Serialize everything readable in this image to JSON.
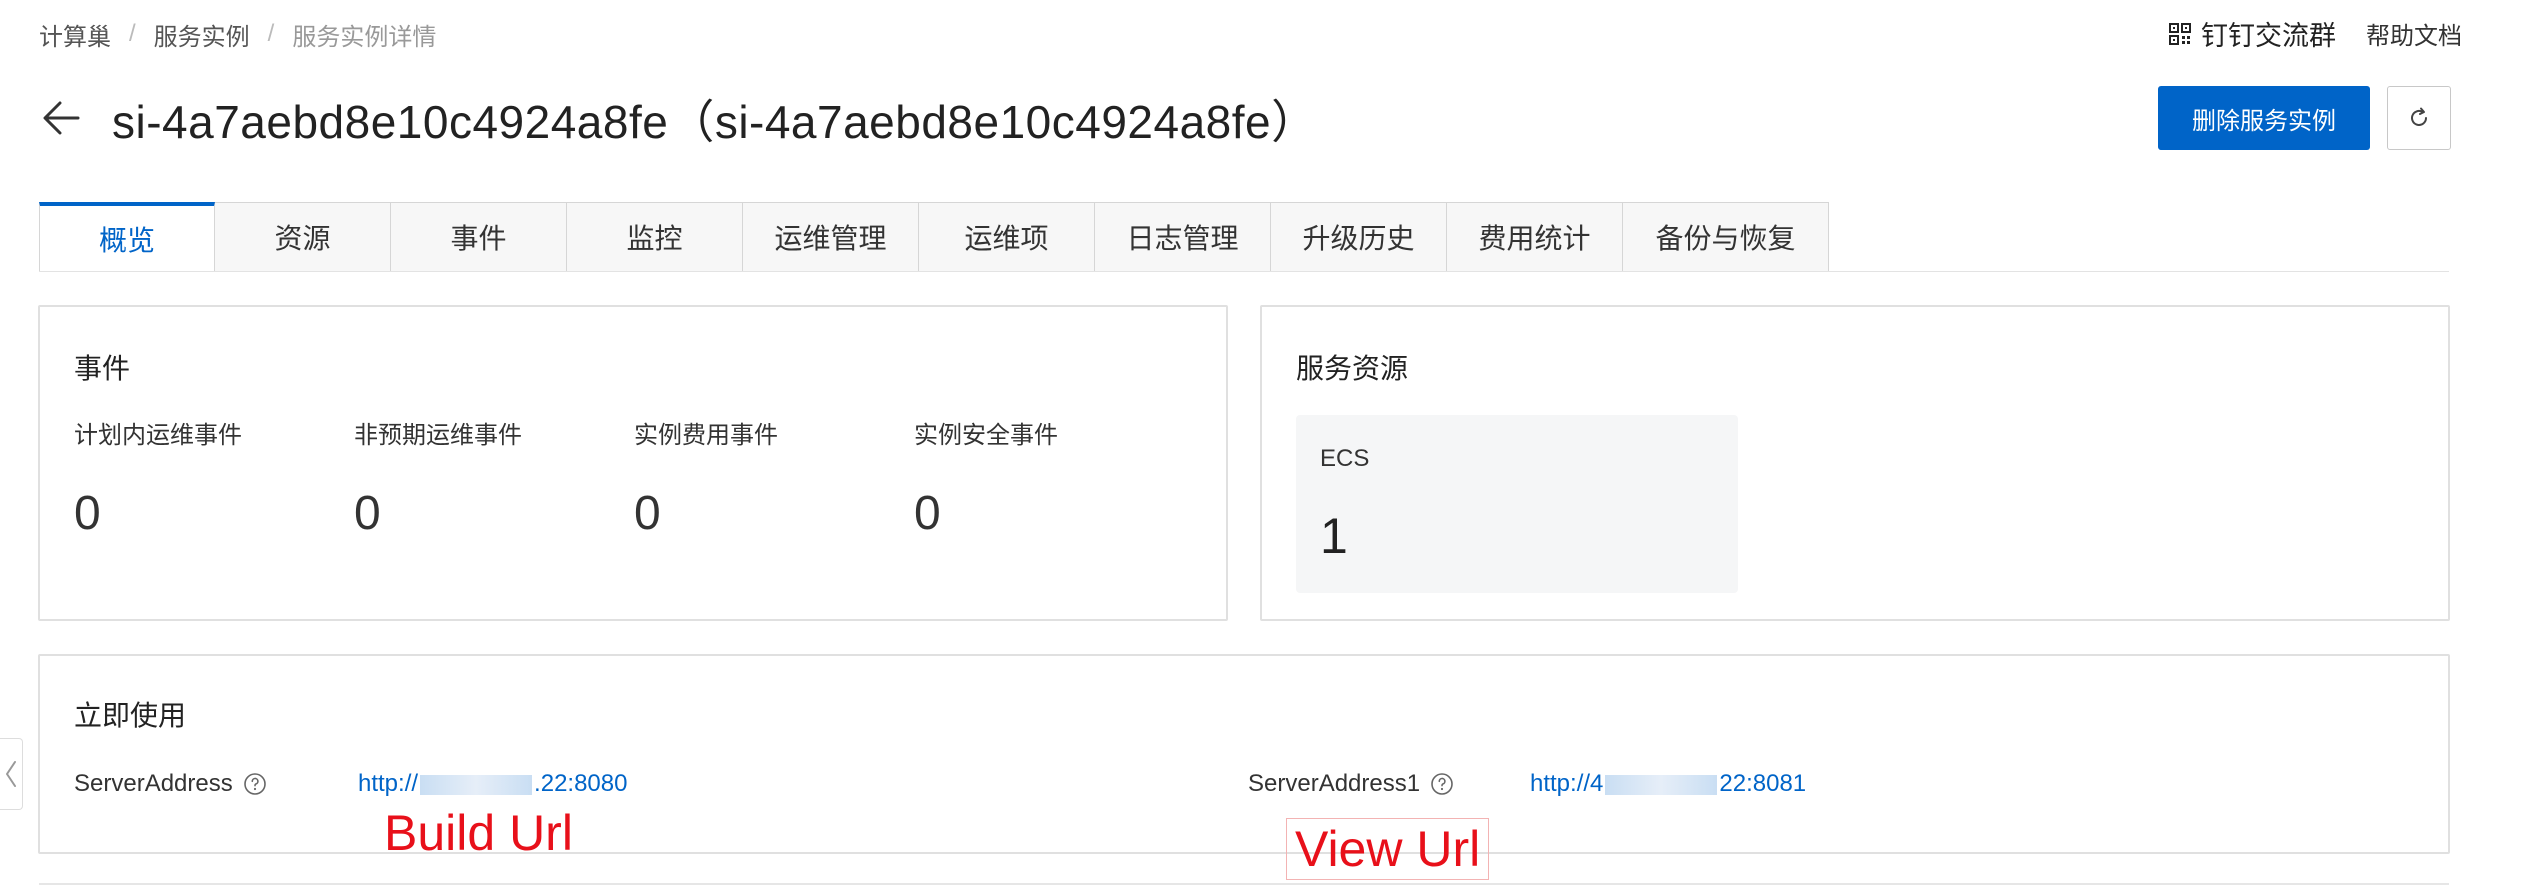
{
  "breadcrumb": {
    "items": [
      "计算巢",
      "服务实例",
      "服务实例详情"
    ],
    "separator": "/"
  },
  "header_links": {
    "dingtalk": "钉钉交流群",
    "help": "帮助文档"
  },
  "page": {
    "title": "si-4a7aebd8e10c4924a8fe（si-4a7aebd8e10c4924a8fe）",
    "delete_button": "删除服务实例"
  },
  "tabs": [
    {
      "label": "概览",
      "active": true
    },
    {
      "label": "资源",
      "active": false
    },
    {
      "label": "事件",
      "active": false
    },
    {
      "label": "监控",
      "active": false
    },
    {
      "label": "运维管理",
      "active": false
    },
    {
      "label": "运维项",
      "active": false
    },
    {
      "label": "日志管理",
      "active": false
    },
    {
      "label": "升级历史",
      "active": false
    },
    {
      "label": "费用统计",
      "active": false
    },
    {
      "label": "备份与恢复",
      "active": false
    }
  ],
  "events": {
    "title": "事件",
    "metrics": [
      {
        "label": "计划内运维事件",
        "value": "0"
      },
      {
        "label": "非预期运维事件",
        "value": "0"
      },
      {
        "label": "实例费用事件",
        "value": "0"
      },
      {
        "label": "实例安全事件",
        "value": "0"
      }
    ]
  },
  "resources": {
    "title": "服务资源",
    "tile": {
      "label": "ECS",
      "value": "1"
    }
  },
  "quick_use": {
    "title": "立即使用",
    "addresses": [
      {
        "label": "ServerAddress",
        "url_prefix": "http://",
        "url_suffix": ".22:8080"
      },
      {
        "label": "ServerAddress1",
        "url_prefix": "http://4",
        "url_suffix": "22:8081"
      }
    ]
  },
  "annotations": {
    "build": "Build Url",
    "view": "View Url"
  },
  "colors": {
    "primary": "#0064c8",
    "annotation": "#e8101a",
    "tile_bg": "#f5f6f7"
  },
  "icons": {
    "back": "arrow-left-icon",
    "refresh": "refresh-icon",
    "qr": "qrcode-icon",
    "help": "question-circle-icon",
    "collapse": "chevron-left-icon"
  }
}
